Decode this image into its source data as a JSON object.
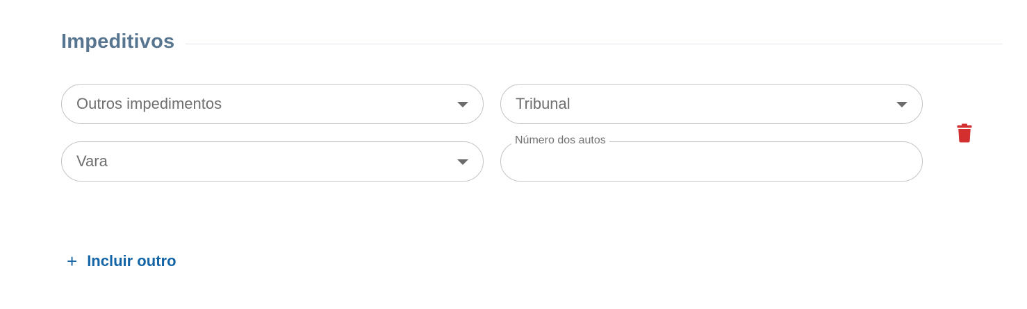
{
  "section": {
    "title": "Impeditivos"
  },
  "row": {
    "impediment_type": {
      "value": "Outros impedimentos"
    },
    "tribunal": {
      "value": "Tribunal"
    },
    "vara": {
      "value": "Vara"
    },
    "numero_autos": {
      "label": "Número dos autos",
      "value": ""
    }
  },
  "actions": {
    "add_label": "Incluir outro",
    "add_icon": "+"
  },
  "icons": {
    "delete": "trash-icon",
    "caret": "caret-down-icon"
  },
  "colors": {
    "title": "#587590",
    "accent": "#1565a6",
    "delete": "#d32f2f",
    "border": "#c4c4c4"
  }
}
